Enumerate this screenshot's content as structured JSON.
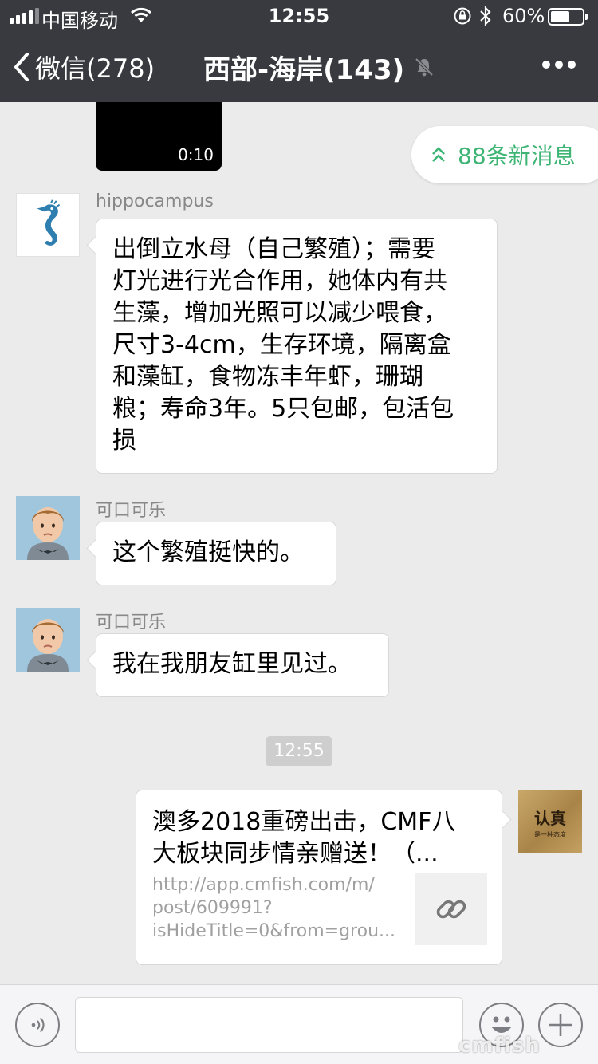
{
  "status_bar": {
    "carrier": "中国移动",
    "time": "12:55",
    "battery_percent": "60%",
    "battery_level": 0.6
  },
  "nav": {
    "back_label": "微信(278)",
    "title": "西部-海岸(143)"
  },
  "new_messages_label": "88条新消息",
  "video": {
    "duration": "0:10"
  },
  "messages": [
    {
      "sender": "hippocampus",
      "lines": [
        "出倒立水母（自己繁殖）；需要",
        "灯光进行光合作用，她体内有共",
        "生藻，增加光照可以减少喂食，",
        "尺寸3-4cm，生存环境，隔离盒",
        "和藻缸，食物冻丰年虾，珊瑚",
        "粮；寿命3年。5只包邮，包活包",
        "损"
      ]
    },
    {
      "sender": "可口可乐",
      "text": "这个繁殖挺快的。"
    },
    {
      "sender": "可口可乐",
      "text": "我在我朋友缸里见过。"
    }
  ],
  "timestamp": "12:55",
  "link_card": {
    "title_lines": [
      "澳多2018重磅出击，CMF八",
      "大板块同步情亲赠送！（..."
    ],
    "desc_lines": [
      "http://app.cmfish.com/m/",
      "post/609991?",
      "isHideTitle=0&from=grou..."
    ]
  },
  "my_avatar": {
    "text": "认真",
    "subtext": "是一种态度"
  },
  "input": {
    "value": "",
    "placeholder": ""
  },
  "watermark": "cmfish",
  "colors": {
    "header": "#393a3f",
    "accent_green": "#3eb575",
    "background": "#ebebeb"
  }
}
